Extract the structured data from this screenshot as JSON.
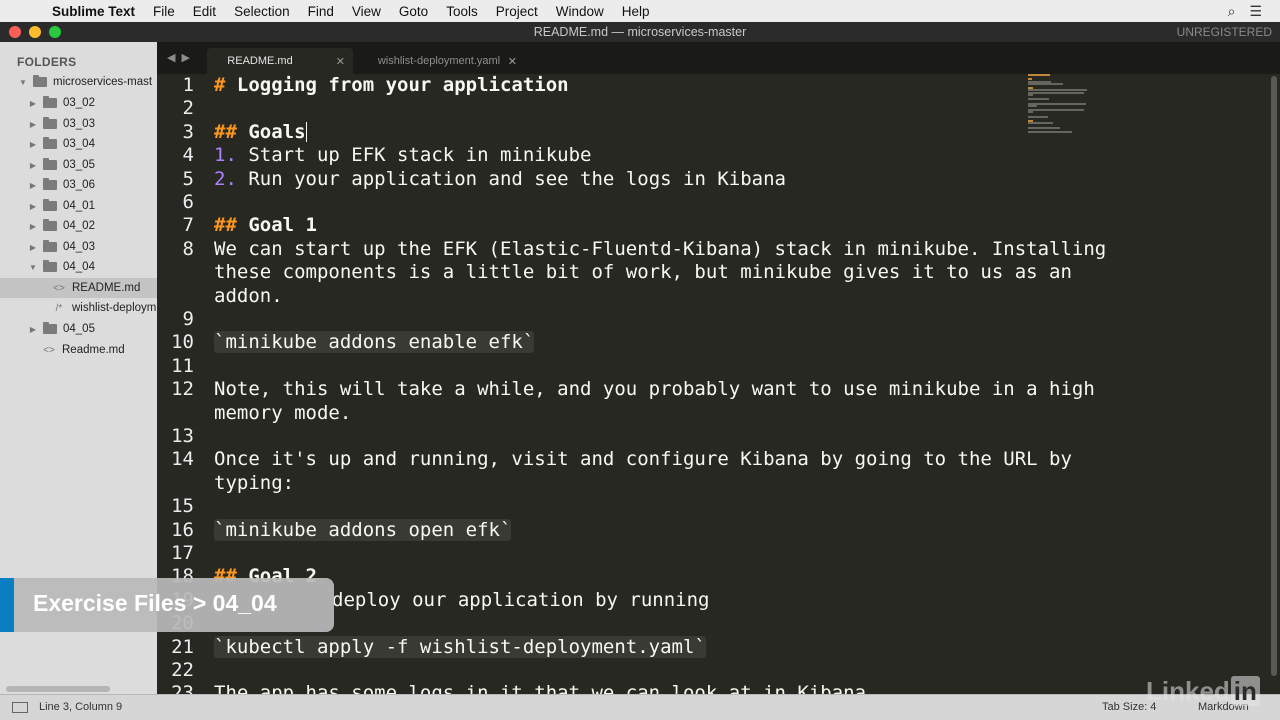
{
  "menubar": {
    "app_name": "Sublime Text",
    "items": [
      "File",
      "Edit",
      "Selection",
      "Find",
      "View",
      "Goto",
      "Tools",
      "Project",
      "Window",
      "Help"
    ]
  },
  "window": {
    "title": "README.md — microservices-master",
    "registration": "UNREGISTERED"
  },
  "tabs": [
    {
      "label": "README.md",
      "active": true
    },
    {
      "label": "wishlist-deployment.yaml",
      "active": false
    }
  ],
  "sidebar": {
    "header": "FOLDERS",
    "root": "microservices-mast",
    "folders": [
      "03_02",
      "03_03",
      "03_04",
      "03_05",
      "03_06",
      "04_01",
      "04_02",
      "04_03",
      "04_04"
    ],
    "open_folder_files": [
      "README.md",
      "wishlist-deploym"
    ],
    "after_folders": [
      "04_05"
    ],
    "root_files": [
      "Readme.md"
    ]
  },
  "editor": {
    "lines": [
      {
        "n": "1",
        "prefix": "#",
        "text": "Logging from your application",
        "kind": "h1"
      },
      {
        "n": "2",
        "text": ""
      },
      {
        "n": "3",
        "prefix": "##",
        "text": "Goals",
        "kind": "h2"
      },
      {
        "n": "4",
        "prefix": "1.",
        "text": "Start up EFK stack in minikube",
        "kind": "ol"
      },
      {
        "n": "5",
        "prefix": "2.",
        "text": "Run your application and see the logs in Kibana",
        "kind": "ol"
      },
      {
        "n": "6",
        "text": ""
      },
      {
        "n": "7",
        "prefix": "##",
        "text": "Goal 1",
        "kind": "h2"
      },
      {
        "n": "8",
        "text": "We can start up the EFK (Elastic-Fluentd-Kibana) stack in minikube. Installing",
        "kind": "p"
      },
      {
        "n": "",
        "text": "these components is a little bit of work, but minikube gives it to us as an",
        "kind": "p"
      },
      {
        "n": "",
        "text": "addon.",
        "kind": "p"
      },
      {
        "n": "9",
        "text": ""
      },
      {
        "n": "10",
        "text": "`minikube addons enable efk`",
        "kind": "code"
      },
      {
        "n": "11",
        "text": ""
      },
      {
        "n": "12",
        "text": "Note, this will take a while, and you probably want to use minikube in a high",
        "kind": "p"
      },
      {
        "n": "",
        "text": "memory mode.",
        "kind": "p"
      },
      {
        "n": "13",
        "text": ""
      },
      {
        "n": "14",
        "text": "Once it's up and running, visit and configure Kibana by going to the URL by",
        "kind": "p"
      },
      {
        "n": "",
        "text": "typing:",
        "kind": "p"
      },
      {
        "n": "15",
        "text": ""
      },
      {
        "n": "16",
        "text": "`minikube addons open efk`",
        "kind": "code"
      },
      {
        "n": "17",
        "text": ""
      },
      {
        "n": "18",
        "prefix": "##",
        "text": "Goal 2",
        "kind": "h2"
      },
      {
        "n": "19",
        "text": "deploy our application by running",
        "kind": "p",
        "indent": 5
      },
      {
        "n": "20",
        "text": ""
      },
      {
        "n": "21",
        "text": "`kubectl apply -f wishlist-deployment.yaml`",
        "kind": "code"
      },
      {
        "n": "22",
        "text": ""
      },
      {
        "n": "23",
        "text": "The app has some logs in it that we can look at in Kibana.",
        "kind": "p"
      }
    ]
  },
  "overlay": {
    "text": "Exercise Files > 04_04"
  },
  "status": {
    "position": "Line 3, Column 9",
    "tab_size": "Tab Size: 4",
    "syntax": "Markdown"
  },
  "watermark": "LinkedIn",
  "colors": {
    "editor_bg": "#272822",
    "heading_hash": "#fd971f",
    "list_number": "#ae81ff",
    "overlay_accent": "#0a7ec3"
  }
}
